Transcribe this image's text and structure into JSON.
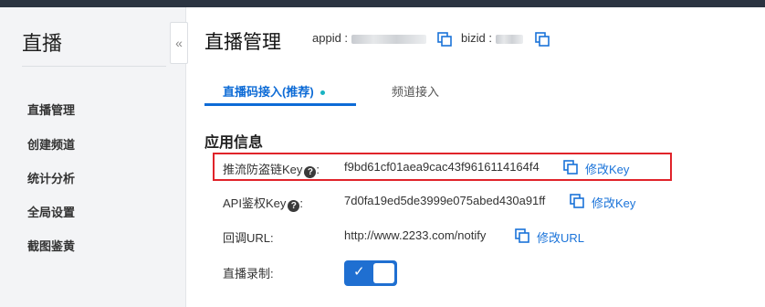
{
  "sidebar": {
    "title": "直播",
    "collapse_glyph": "«",
    "items": [
      {
        "label": "直播管理"
      },
      {
        "label": "创建频道"
      },
      {
        "label": "统计分析"
      },
      {
        "label": "全局设置"
      },
      {
        "label": "截图鉴黄"
      }
    ]
  },
  "header": {
    "title": "直播管理",
    "appid_label": "appid :",
    "bizid_label": "bizid :"
  },
  "tabs": [
    {
      "label": "直播码接入(推荐)",
      "active": true
    },
    {
      "label": "频道接入",
      "active": false
    }
  ],
  "section": {
    "title": "应用信息",
    "rows": [
      {
        "label": "推流防盗链Key",
        "colon": ":",
        "value": "f9bd61cf01aea9cac43f9616114164f4",
        "action": "修改Key",
        "has_help": true
      },
      {
        "label": "API鉴权Key",
        "colon": ":",
        "value": "7d0fa19ed5de3999e075abed430a91ff",
        "action": "修改Key",
        "has_help": true
      },
      {
        "label": "回调URL:",
        "value": "http://www.2233.com/notify",
        "action": "修改URL"
      },
      {
        "label": "直播录制:",
        "toggle_on": true
      }
    ]
  },
  "icons": {
    "help": "?",
    "copy": "copy-icon",
    "check": "✓"
  },
  "colors": {
    "accent": "#0d6bd6",
    "link": "#1a73d9",
    "highlight": "#e0232a",
    "toggle": "#1f6fd1",
    "topbar": "#2b3441"
  }
}
